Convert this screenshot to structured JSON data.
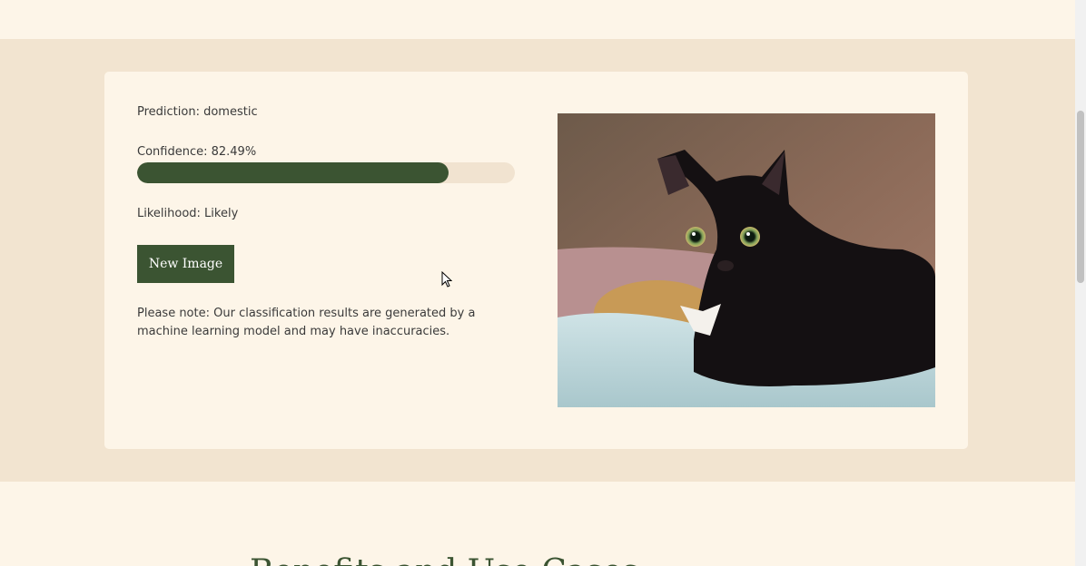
{
  "result": {
    "prediction_text": "Prediction: domestic",
    "confidence_text": "Confidence: 82.49%",
    "confidence_percent": 82.49,
    "likelihood_text": "Likelihood: Likely",
    "new_image_label": "New Image",
    "note_text": "Please note: Our classification results are generated by a machine learning model and may have inaccuracies."
  },
  "next_section": {
    "heading": "Benefits and Use Cases"
  },
  "colors": {
    "accent": "#3b5432",
    "band": "#f2e4d0",
    "card": "#fdf5e8"
  }
}
